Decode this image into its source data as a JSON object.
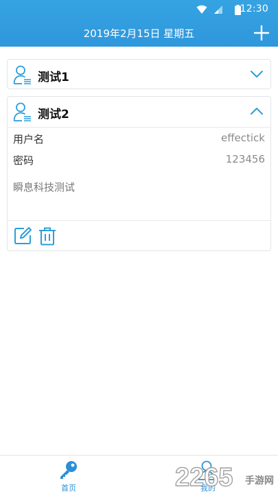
{
  "status_bar": {
    "time": "12:30"
  },
  "header": {
    "title": "2019年2月15日 星期五"
  },
  "accounts": [
    {
      "name": "测试1",
      "expanded": false
    },
    {
      "name": "测试2",
      "expanded": true,
      "fields": [
        {
          "label": "用户名",
          "value": "effectick"
        },
        {
          "label": "密码",
          "value": "123456"
        }
      ],
      "note": "瞬息科技测试"
    }
  ],
  "bottom_nav": {
    "items": [
      {
        "label": "首页",
        "icon": "key-icon",
        "active": true
      },
      {
        "label": "我的",
        "icon": "user-icon",
        "active": false
      }
    ]
  },
  "watermark": {
    "text": "2265手游网"
  },
  "colors": {
    "primary": "#2f97dc",
    "accent_icon": "#2b9ed8",
    "text_gray": "#8a8a8a"
  }
}
